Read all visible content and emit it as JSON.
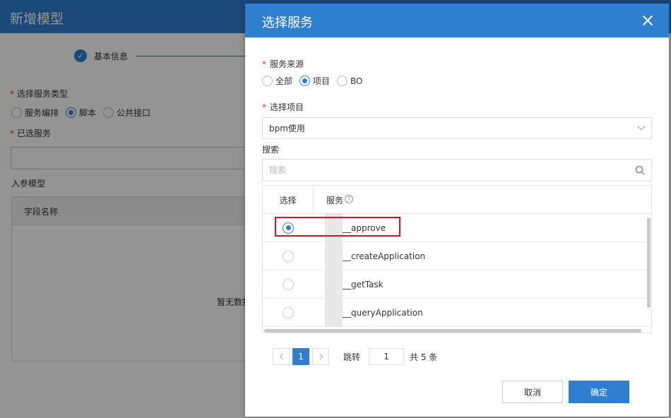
{
  "background": {
    "title": "新增模型",
    "step_label": "基本信息",
    "service_type_label": "选择服务类型",
    "service_type_options": [
      "服务编排",
      "脚本",
      "公共接口"
    ],
    "service_type_selected": "脚本",
    "selected_service_label": "已选服务",
    "input_model_label": "入参模型",
    "table_header_field": "字段名称",
    "empty_text": "暂无数据"
  },
  "dialog": {
    "title": "选择服务",
    "source_label": "服务来源",
    "source_options": [
      "全部",
      "项目",
      "BO"
    ],
    "source_selected": "项目",
    "project_label": "选择项目",
    "project_value": "bpm使用",
    "search_label": "搜索",
    "search_placeholder": "搜索",
    "table": {
      "col_select": "选择",
      "col_service": "服务",
      "help_glyph": "?",
      "rows": [
        {
          "name": "__approve",
          "selected": true
        },
        {
          "name": "__createApplication",
          "selected": false
        },
        {
          "name": "__getTask",
          "selected": false
        },
        {
          "name": "__queryApplication",
          "selected": false
        }
      ]
    },
    "pagination": {
      "current_page": "1",
      "jump_label": "跳转",
      "jump_value": "1",
      "total_text": "共 5 条"
    },
    "cancel_label": "取消",
    "ok_label": "确定"
  },
  "colors": {
    "primary": "#2f7fd1",
    "required": "#e4393c",
    "highlight": "#d9141c"
  },
  "icons": {
    "close": "close-icon",
    "search": "search-icon",
    "help": "help-icon",
    "check": "check-icon",
    "chevron": "chevron-down-icon"
  }
}
